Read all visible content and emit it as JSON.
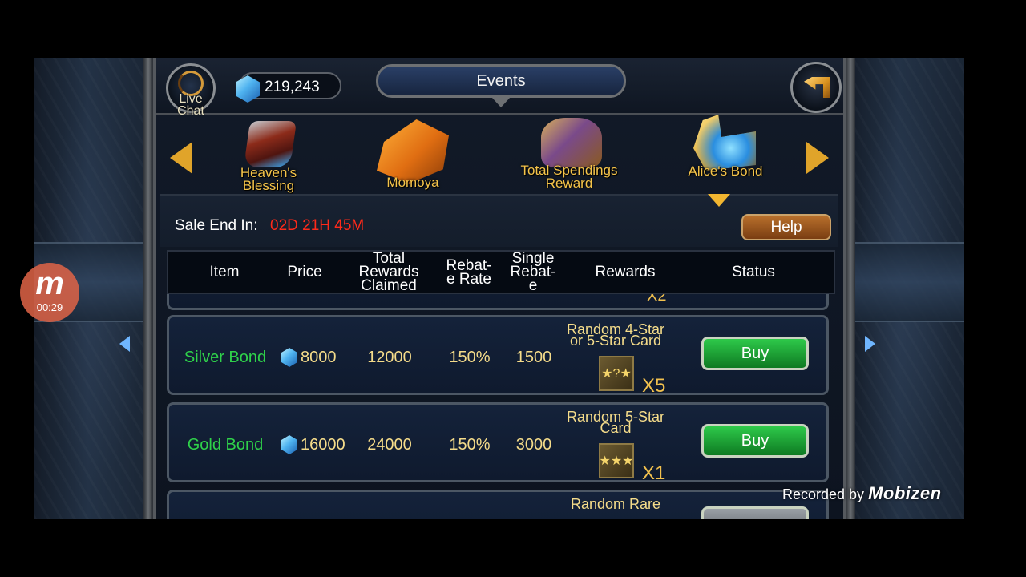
{
  "header": {
    "live_chat": "Live\nChat",
    "gems": "219,243",
    "title": "Events"
  },
  "events": [
    {
      "label": "Heaven's\nBlessing",
      "icon": "armored-boot-icon"
    },
    {
      "label": "Momoya",
      "icon": "gift-box-icon"
    },
    {
      "label": "Total Spendings\nReward",
      "icon": "treasure-pile-icon"
    },
    {
      "label": "Alice's Bond",
      "icon": "gem-chest-icon",
      "selected": true
    }
  ],
  "sale": {
    "label": "Sale End In:",
    "time": "02D 21H 45M"
  },
  "help_label": "Help",
  "table": {
    "headers": [
      "Item",
      "Price",
      "Total\nRewards\nClaimed",
      "Rebat-\ne Rate",
      "Single\nRebat-\ne",
      "Rewards",
      "Status"
    ],
    "prev_row_qty": "X2",
    "rows": [
      {
        "item": "Silver Bond",
        "price": "8000",
        "total": "12000",
        "rate": "150%",
        "single": "1500",
        "reward": "Random 4-Star\nor 5-Star Card",
        "qty": "X5",
        "status": "Buy"
      },
      {
        "item": "Gold Bond",
        "price": "16000",
        "total": "24000",
        "rate": "150%",
        "single": "3000",
        "reward": "Random 5-Star\nCard",
        "qty": "X1",
        "status": "Buy"
      },
      {
        "reward": "Random Rare"
      }
    ]
  },
  "recorder": {
    "logo": "m",
    "time": "00:29",
    "recorded_by": "Recorded by",
    "brand": "Mobizen"
  },
  "colors": {
    "accent_gold": "#f5c44a",
    "item_green": "#2fd24a",
    "timer_red": "#ff2a1a",
    "buy_green": "#1ea83a"
  }
}
